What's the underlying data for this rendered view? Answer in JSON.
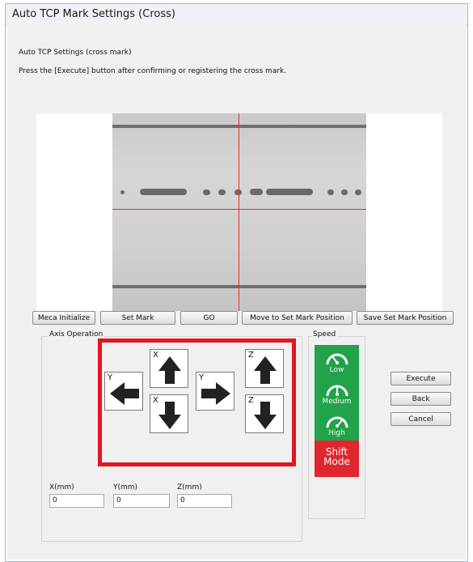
{
  "window": {
    "title": "Auto TCP Mark Settings (Cross)"
  },
  "content": {
    "heading": "Auto TCP Settings (cross mark)",
    "instruction": "Press the [Execute] button after confirming or registering the cross mark."
  },
  "buttons": {
    "meca_initialize": "Meca Initialize",
    "set_mark": "Set Mark",
    "go": "GO",
    "move_to_set_mark": "Move to Set Mark Position",
    "save_set_mark": "Save Set Mark Position",
    "execute": "Execute",
    "back": "Back",
    "cancel": "Cancel"
  },
  "axis_operation": {
    "group_label": "Axis Operation",
    "jog_buttons": [
      {
        "axis": "X",
        "direction": "up",
        "icon": "arrow-up-icon"
      },
      {
        "axis": "X",
        "direction": "down",
        "icon": "arrow-down-icon"
      },
      {
        "axis": "Y",
        "direction": "left",
        "icon": "arrow-left-icon"
      },
      {
        "axis": "Y",
        "direction": "right",
        "icon": "arrow-right-icon"
      },
      {
        "axis": "Z",
        "direction": "up",
        "icon": "arrow-up-icon"
      },
      {
        "axis": "Z",
        "direction": "down",
        "icon": "arrow-down-icon"
      }
    ],
    "labels": {
      "x": "X",
      "y": "Y",
      "z": "Z"
    },
    "fields": {
      "x_label": "X(mm)",
      "x_value": "0",
      "y_label": "Y(mm)",
      "y_value": "0",
      "z_label": "Z(mm)",
      "z_value": "0"
    }
  },
  "speed": {
    "group_label": "Speed",
    "low": "Low",
    "medium": "Medium",
    "high": "High",
    "shift_line1": "Shift",
    "shift_line2": "Mode"
  },
  "colors": {
    "highlight": "#e3151f",
    "speed_green": "#22a24a",
    "shift_red": "#e0262f",
    "crosshair": "#e23030"
  }
}
